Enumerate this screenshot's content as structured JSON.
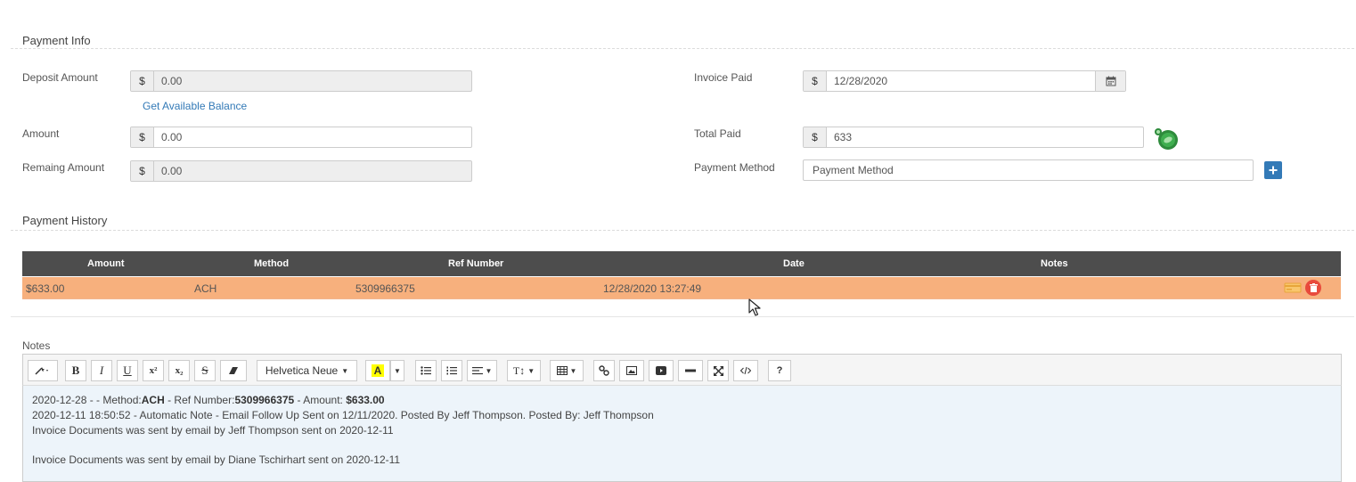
{
  "payment_info": {
    "title": "Payment Info",
    "deposit_amount": {
      "label": "Deposit Amount",
      "currency": "$",
      "value": "0.00"
    },
    "get_balance_link": "Get Available Balance",
    "amount": {
      "label": "Amount",
      "currency": "$",
      "value": "0.00"
    },
    "remaining_amount": {
      "label": "Remaing Amount",
      "currency": "$",
      "value": "0.00"
    },
    "invoice_paid": {
      "label": "Invoice Paid",
      "currency": "$",
      "value": "12/28/2020"
    },
    "total_paid": {
      "label": "Total Paid",
      "currency": "$",
      "value": "633"
    },
    "payment_method": {
      "label": "Payment Method",
      "placeholder": "Payment Method",
      "add_icon": "plus"
    }
  },
  "payment_history": {
    "title": "Payment History",
    "columns": [
      "Amount",
      "Method",
      "Ref Number",
      "Date",
      "Notes"
    ],
    "rows": [
      {
        "amount": "$633.00",
        "method": "ACH",
        "ref_number": "5309966375",
        "date": "12/28/2020 13:27:49",
        "notes": ""
      }
    ]
  },
  "notes": {
    "title": "Notes",
    "toolbar": {
      "font_name": "Helvetica Neue",
      "bold": "B",
      "italic": "I",
      "underline": "U",
      "superscript": "x²",
      "subscript": "x₂",
      "strikethrough": "S",
      "text_size": "T↕",
      "help": "?"
    },
    "lines": [
      {
        "pre": "2020-12-28 - - Method:",
        "b1": "ACH",
        "mid": " - Ref Number:",
        "b2": "5309966375",
        "mid2": " - Amount: ",
        "b3": "$633.00"
      },
      {
        "text": "2020-12-11 18:50:52 - Automatic Note - Email Follow Up Sent on 12/11/2020. Posted By Jeff Thompson. Posted By: Jeff Thompson"
      },
      {
        "text": "Invoice Documents was sent by email by Jeff Thompson sent on 2020-12-11"
      },
      {
        "text": "Invoice Documents was sent by email by Diane Tschirhart sent on 2020-12-11"
      }
    ]
  },
  "colors": {
    "table_header_bg": "#4d4d4d",
    "row_highlight": "#f7b07d",
    "link": "#337ab7",
    "primary_button": "#337ab7",
    "delete_icon": "#e84a3c",
    "money_icon": "#2e8b3c",
    "editor_bg": "#edf4fa"
  }
}
